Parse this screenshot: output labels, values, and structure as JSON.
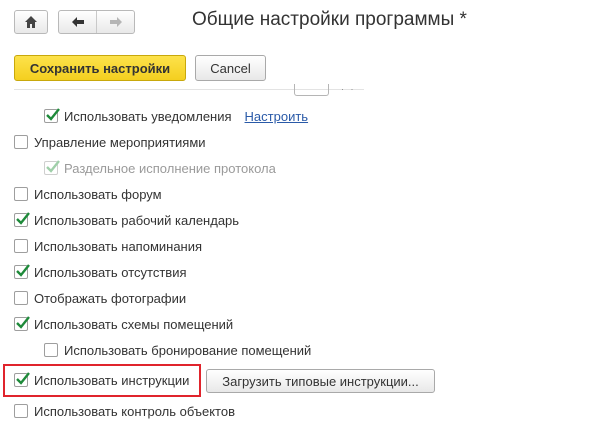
{
  "window": {
    "title": "Общие настройки программы *"
  },
  "toolbar": {
    "save_label": "Сохранить настройки",
    "cancel_label": "Cancel"
  },
  "settings": {
    "use_notifications": {
      "label": "Использовать уведомления",
      "checked": true,
      "link": "Настроить"
    },
    "event_management": {
      "label": "Управление мероприятиями",
      "checked": false
    },
    "separate_protocol": {
      "label": "Раздельное исполнение протокола",
      "checked": true,
      "disabled": true
    },
    "use_forum": {
      "label": "Использовать форум",
      "checked": false
    },
    "use_work_calendar": {
      "label": "Использовать рабочий календарь",
      "checked": true
    },
    "use_reminders": {
      "label": "Использовать напоминания",
      "checked": false
    },
    "use_absences": {
      "label": "Использовать отсутствия",
      "checked": true
    },
    "show_photos": {
      "label": "Отображать фотографии",
      "checked": false
    },
    "use_room_schemes": {
      "label": "Использовать схемы помещений",
      "checked": true
    },
    "use_room_booking": {
      "label": "Использовать бронирование помещений",
      "checked": false
    },
    "use_instructions": {
      "label": "Использовать инструкции",
      "checked": true,
      "button": "Загрузить типовые инструкции..."
    },
    "use_object_control": {
      "label": "Использовать контроль объектов",
      "checked": false
    }
  },
  "colors": {
    "check": "#1e8a3a",
    "check_disabled": "#9fcfa9",
    "accent": "#f6d42c",
    "highlight": "#e0242c",
    "link": "#2a5aa8"
  }
}
